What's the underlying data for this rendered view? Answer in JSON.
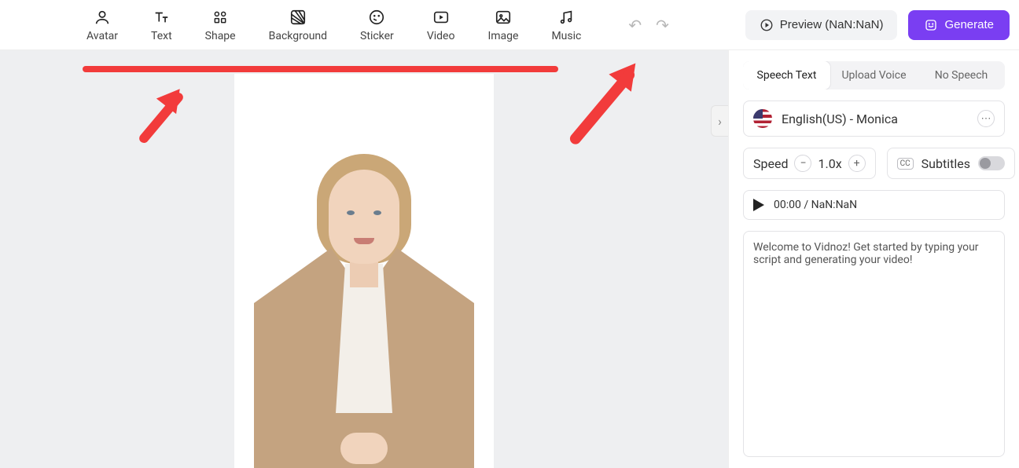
{
  "toolbar": {
    "items": [
      {
        "label": "Avatar"
      },
      {
        "label": "Text"
      },
      {
        "label": "Shape"
      },
      {
        "label": "Background"
      },
      {
        "label": "Sticker"
      },
      {
        "label": "Video"
      },
      {
        "label": "Image"
      },
      {
        "label": "Music"
      }
    ],
    "preview_label": "Preview (NaN:NaN)",
    "generate_label": "Generate"
  },
  "side": {
    "tabs": {
      "speech": "Speech Text",
      "upload": "Upload Voice",
      "none": "No Speech"
    },
    "voice_label": "English(US) - Monica",
    "speed_label": "Speed",
    "speed_value": "1.0x",
    "subtitles_label": "Subtitles",
    "time_label": "00:00 / NaN:NaN",
    "script_placeholder": "Welcome to Vidnoz! Get started by typing your script and generating your video!"
  }
}
